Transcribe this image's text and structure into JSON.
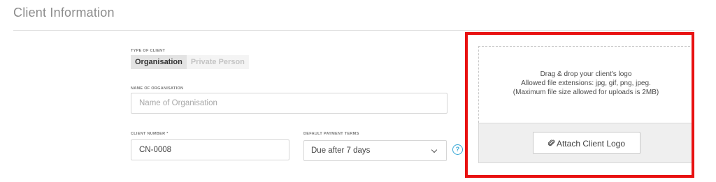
{
  "section": {
    "title": "Client Information"
  },
  "client_type": {
    "label": "TYPE OF CLIENT",
    "options": [
      "Organisation",
      "Private Person"
    ],
    "selected": "Organisation"
  },
  "organisation": {
    "label": "NAME OF ORGANISATION",
    "value": "",
    "placeholder": "Name of Organisation"
  },
  "client_number": {
    "label": "CLIENT NUMBER *",
    "value": "CN-0008"
  },
  "payment_terms": {
    "label": "DEFAULT PAYMENT TERMS",
    "selected": "Due after 7 days",
    "help_glyph": "?"
  },
  "logo_upload": {
    "drop_line1": "Drag & drop your client's logo",
    "drop_line2": "Allowed file extensions: jpg, gif, png, jpeg.",
    "drop_line3": "(Maximum file size allowed for uploads is 2MB)",
    "button_label": "Attach Client Logo",
    "button_icon": "paperclip-icon"
  },
  "colors": {
    "highlight": "#e81111",
    "help": "#38a8d6"
  }
}
